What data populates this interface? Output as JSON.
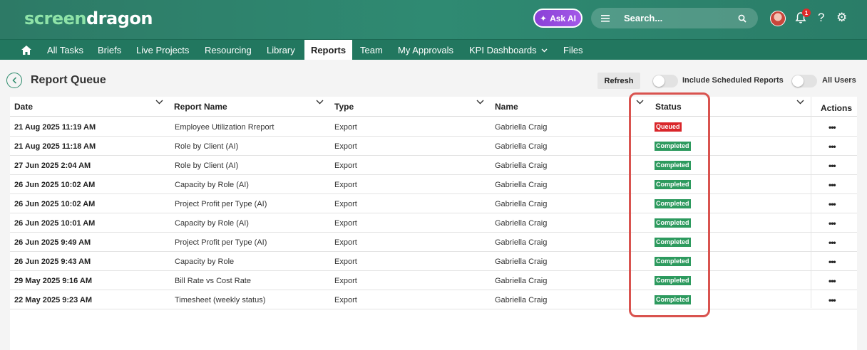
{
  "header": {
    "logo_part1": "screen",
    "logo_part2": "dragon",
    "ask_ai_label": "Ask AI",
    "search_placeholder": "Search...",
    "notification_count": "1"
  },
  "nav": {
    "items": [
      {
        "label": "All Tasks"
      },
      {
        "label": "Briefs"
      },
      {
        "label": "Live Projects"
      },
      {
        "label": "Resourcing"
      },
      {
        "label": "Library"
      },
      {
        "label": "Reports"
      },
      {
        "label": "Team"
      },
      {
        "label": "My Approvals"
      },
      {
        "label": "KPI Dashboards"
      },
      {
        "label": "Files"
      }
    ],
    "active": "Reports"
  },
  "page": {
    "title": "Report Queue",
    "refresh_label": "Refresh",
    "toggle_scheduled_label": "Include Scheduled Reports",
    "toggle_all_users_label": "All Users"
  },
  "table": {
    "columns": [
      "Date",
      "Report Name",
      "Type",
      "Name",
      "Status",
      "Actions"
    ],
    "rows": [
      {
        "date": "21 Aug 2025 11:19  AM",
        "report": "Employee Utilization Rreport",
        "type": "Export",
        "name": "Gabriella Craig",
        "status": "Queued"
      },
      {
        "date": "21 Aug 2025 11:18  AM",
        "report": "Role by Client (AI)",
        "type": "Export",
        "name": "Gabriella Craig",
        "status": "Completed"
      },
      {
        "date": "27 Jun 2025 2:04  AM",
        "report": "Role by Client (AI)",
        "type": "Export",
        "name": "Gabriella Craig",
        "status": "Completed"
      },
      {
        "date": "26 Jun 2025 10:02  AM",
        "report": "Capacity by Role (AI)",
        "type": "Export",
        "name": "Gabriella Craig",
        "status": "Completed"
      },
      {
        "date": "26 Jun 2025 10:02  AM",
        "report": "Project Profit per Type (AI)",
        "type": "Export",
        "name": "Gabriella Craig",
        "status": "Completed"
      },
      {
        "date": "26 Jun 2025 10:01  AM",
        "report": "Capacity by Role (AI)",
        "type": "Export",
        "name": "Gabriella Craig",
        "status": "Completed"
      },
      {
        "date": "26 Jun 2025 9:49  AM",
        "report": "Project Profit per Type (AI)",
        "type": "Export",
        "name": "Gabriella Craig",
        "status": "Completed"
      },
      {
        "date": "26 Jun 2025 9:43  AM",
        "report": "Capacity by Role",
        "type": "Export",
        "name": "Gabriella Craig",
        "status": "Completed"
      },
      {
        "date": "29 May 2025 9:16  AM",
        "report": "Bill Rate vs Cost Rate",
        "type": "Export",
        "name": "Gabriella Craig",
        "status": "Completed"
      },
      {
        "date": "22 May 2025 9:23  AM",
        "report": "Timesheet (weekly status)",
        "type": "Export",
        "name": "Gabriella Craig",
        "status": "Completed"
      }
    ],
    "actions_glyph": "•••"
  },
  "colors": {
    "header_bg": "#2f8a72",
    "nav_bg": "#22775f",
    "queued": "#d9262a",
    "completed": "#2d9a5e",
    "highlight": "#d9534f"
  }
}
